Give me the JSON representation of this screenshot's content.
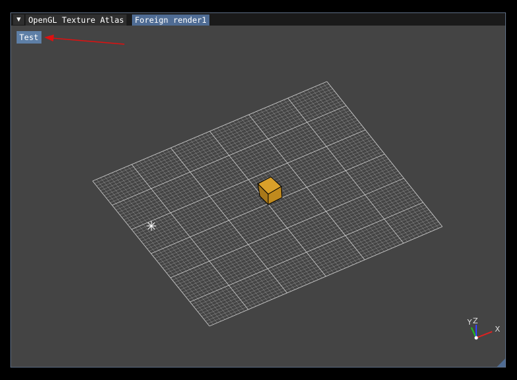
{
  "tabs": {
    "menu_glyph": "▼",
    "items": [
      {
        "label": "OpenGL Texture Atlas"
      },
      {
        "label": "Foreign render1"
      }
    ]
  },
  "viewport": {
    "button_label": "Test",
    "axis_labels": {
      "y": "Y",
      "z": "Z",
      "x": "X"
    }
  },
  "colors": {
    "window_bg": "#444444",
    "active_tab": "#4f6c94",
    "button": "#5e7fa6",
    "arrow": "#dd1111",
    "cube": "#d9a02a",
    "grid": "#cfcfcf",
    "axis_x": "#e02020",
    "axis_y": "#20c020",
    "axis_z": "#3040ff"
  },
  "icons": {
    "cursor": "crosshair-icon",
    "tab_menu": "chevron-down-icon"
  }
}
